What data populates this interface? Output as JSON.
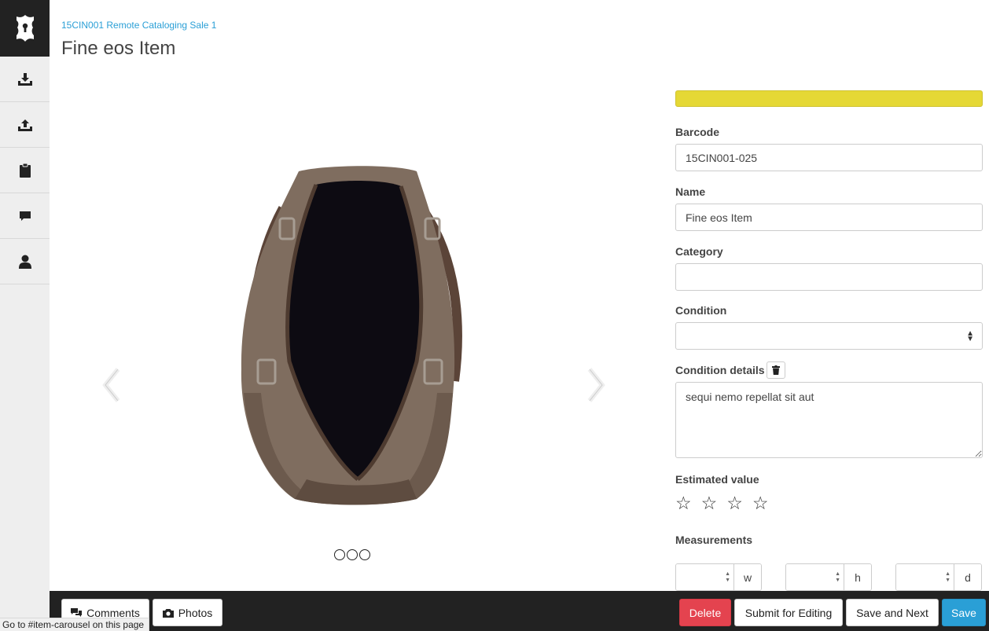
{
  "breadcrumb": "15CIN001 Remote Cataloging Sale 1",
  "title": "Fine eos Item",
  "sidebar": {
    "items": [
      {
        "icon": "download-tray-icon"
      },
      {
        "icon": "upload-tray-icon"
      },
      {
        "icon": "clipboard-icon"
      },
      {
        "icon": "comment-icon"
      },
      {
        "icon": "user-icon"
      }
    ]
  },
  "carousel": {
    "image": "handbag-photo",
    "slide_count": 3
  },
  "status_color": "#e5d835",
  "form": {
    "barcode_label": "Barcode",
    "barcode_value": "15CIN001-025",
    "name_label": "Name",
    "name_value": "Fine eos Item",
    "category_label": "Category",
    "category_value": "",
    "condition_label": "Condition",
    "condition_value": "",
    "condition_details_label": "Condition details",
    "condition_details_value": "sequi nemo repellat sit aut",
    "estimated_value_label": "Estimated value",
    "stars": [
      "☆",
      "☆",
      "☆",
      "☆"
    ],
    "measurements_label": "Measurements",
    "measurements": [
      {
        "value": "",
        "unit": "w"
      },
      {
        "value": "",
        "unit": "h"
      },
      {
        "value": "",
        "unit": "d"
      }
    ]
  },
  "footer": {
    "comments_label": "Comments",
    "photos_label": "Photos",
    "delete_label": "Delete",
    "submit_label": "Submit for Editing",
    "save_next_label": "Save and Next",
    "save_label": "Save"
  },
  "status_tooltip": "Go to #item-carousel on this page"
}
